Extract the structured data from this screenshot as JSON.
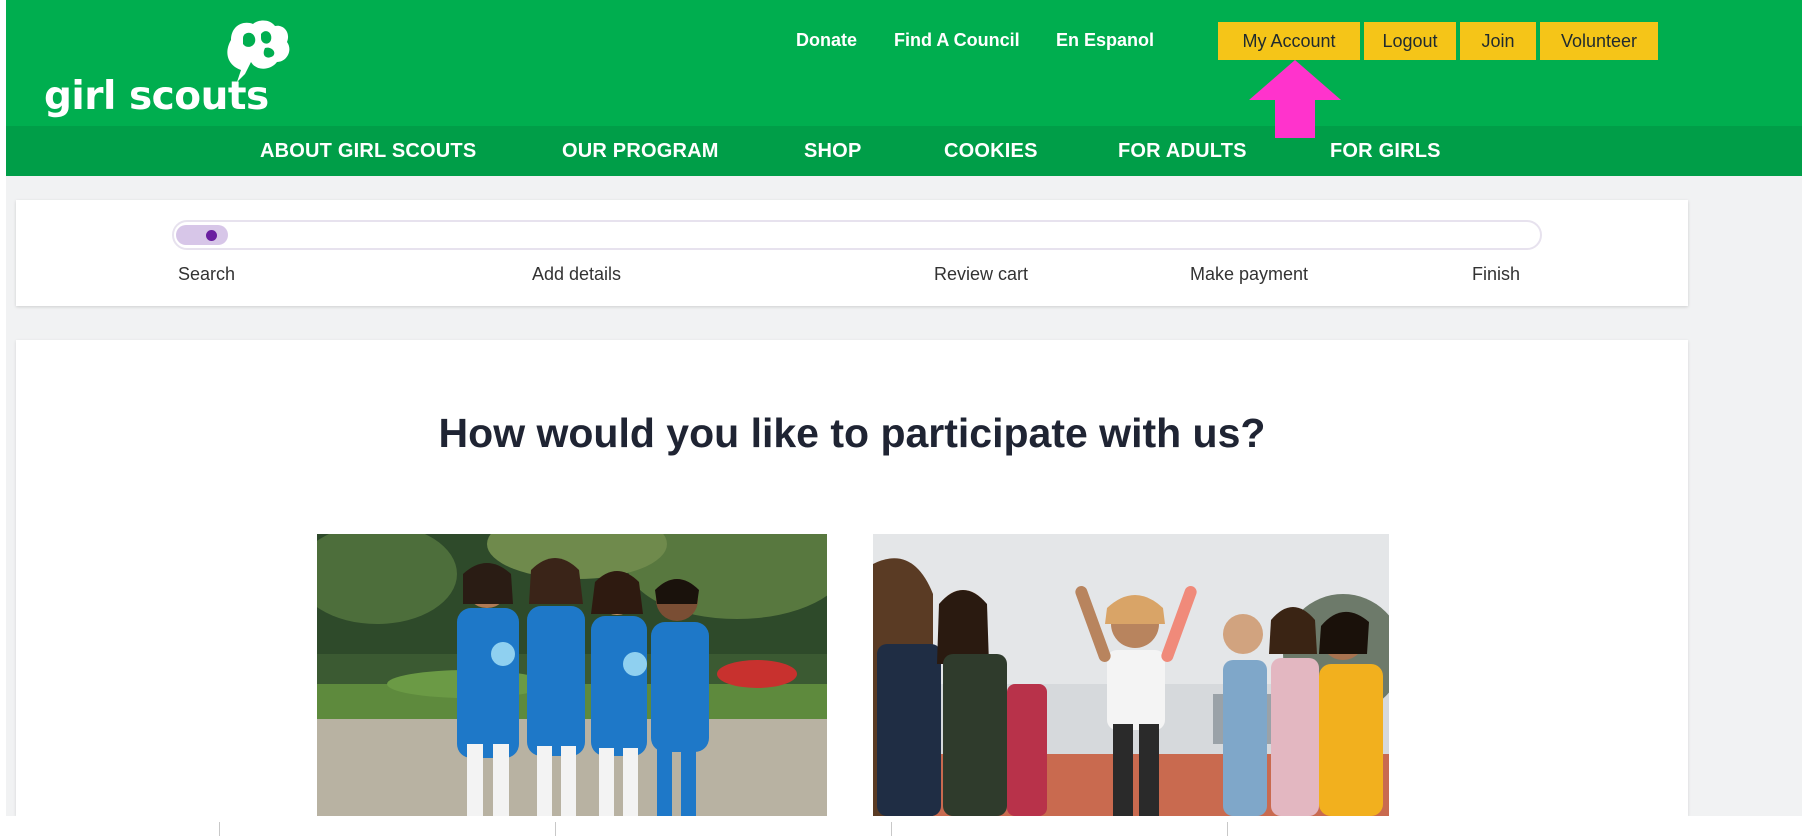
{
  "brand": {
    "logo_text": "girl scouts",
    "primary_green": "#00ae4f",
    "nav_green": "#009e48",
    "accent_yellow": "#f5c518",
    "highlight_pink": "#ff33cc"
  },
  "utility_nav": {
    "links": [
      "Donate",
      "Find A Council",
      "En Espanol"
    ],
    "buttons": [
      "My Account",
      "Logout",
      "Join",
      "Volunteer"
    ]
  },
  "main_nav": [
    "ABOUT GIRL SCOUTS",
    "OUR PROGRAM",
    "SHOP",
    "COOKIES",
    "FOR ADULTS",
    "FOR GIRLS"
  ],
  "stepper": {
    "steps": [
      "Search",
      "Add details",
      "Review cart",
      "Make payment",
      "Finish"
    ],
    "current_step": "Search"
  },
  "main": {
    "heading": "How would you like to participate with us?"
  },
  "icons": {
    "logo": "trefoil-logo-icon",
    "highlight": "arrow-up-icon"
  }
}
